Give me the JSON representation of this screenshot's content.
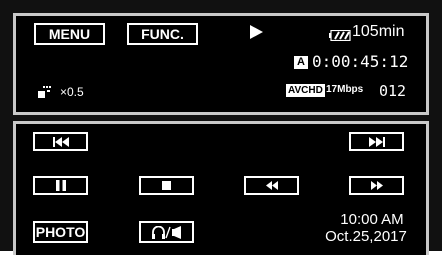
{
  "top_panel": {
    "menu_label": "MENU",
    "func_label": "FUNC.",
    "play_status_icon": "play-icon",
    "battery_icon": "battery-icon",
    "battery_time": "105min",
    "a_badge": "A",
    "timecode": "0:00:45:12",
    "speed_icon": "slow-motion-icon",
    "speed": "×0.5",
    "format_badge": "AVCHD",
    "bitrate": "17Mbps",
    "scene_number": "012"
  },
  "controls": {
    "skip_back_icon": "skip-to-start-icon",
    "skip_forward_icon": "skip-to-end-icon",
    "pause_icon": "pause-icon",
    "stop_icon": "stop-icon",
    "rewind_icon": "rewind-icon",
    "fast_forward_icon": "fast-forward-icon",
    "photo_label": "PHOTO",
    "volume_icon": "headphones-speaker-icon",
    "time": "10:00 AM",
    "date": "Oct.25,2017"
  },
  "colors": {
    "background": "#000000",
    "frame": "#c9c9c9",
    "text": "#ffffff"
  }
}
